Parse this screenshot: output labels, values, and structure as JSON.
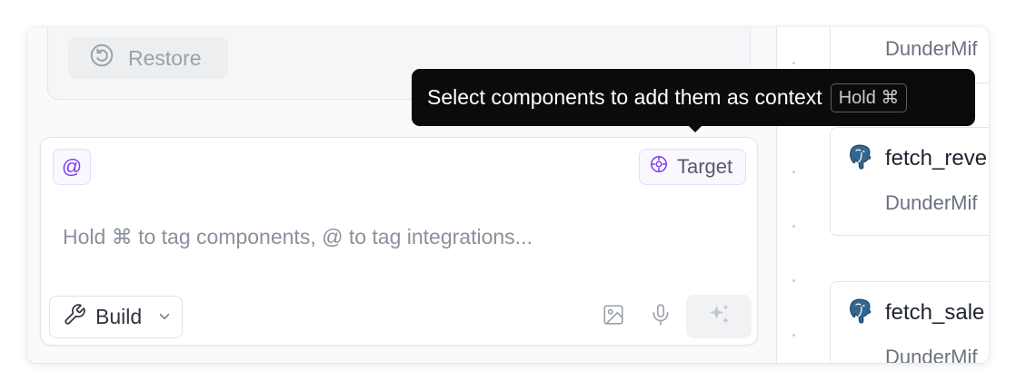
{
  "history": {
    "restore_label": "Restore"
  },
  "composer": {
    "mention_label": "@",
    "target_label": "Target",
    "placeholder": "Hold ⌘ to tag components, @ to tag integrations...",
    "mode_label": "Build"
  },
  "tooltip": {
    "text": "Select components to add them as context",
    "shortcut": "Hold ⌘"
  },
  "nodes": [
    {
      "title": "",
      "subtitle": "DunderMif",
      "icon": "postgres-elephant-icon"
    },
    {
      "title": "fetch_reve",
      "subtitle": "DunderMif",
      "icon": "postgres-elephant-icon"
    },
    {
      "title": "fetch_sale",
      "subtitle": "DunderMif",
      "icon": "postgres-elephant-icon"
    }
  ],
  "colors": {
    "accent": "#7c3aed",
    "accent_border": "#e6dcfb",
    "tooltip_bg": "#0b0b0c",
    "postgres_blue": "#336791"
  }
}
